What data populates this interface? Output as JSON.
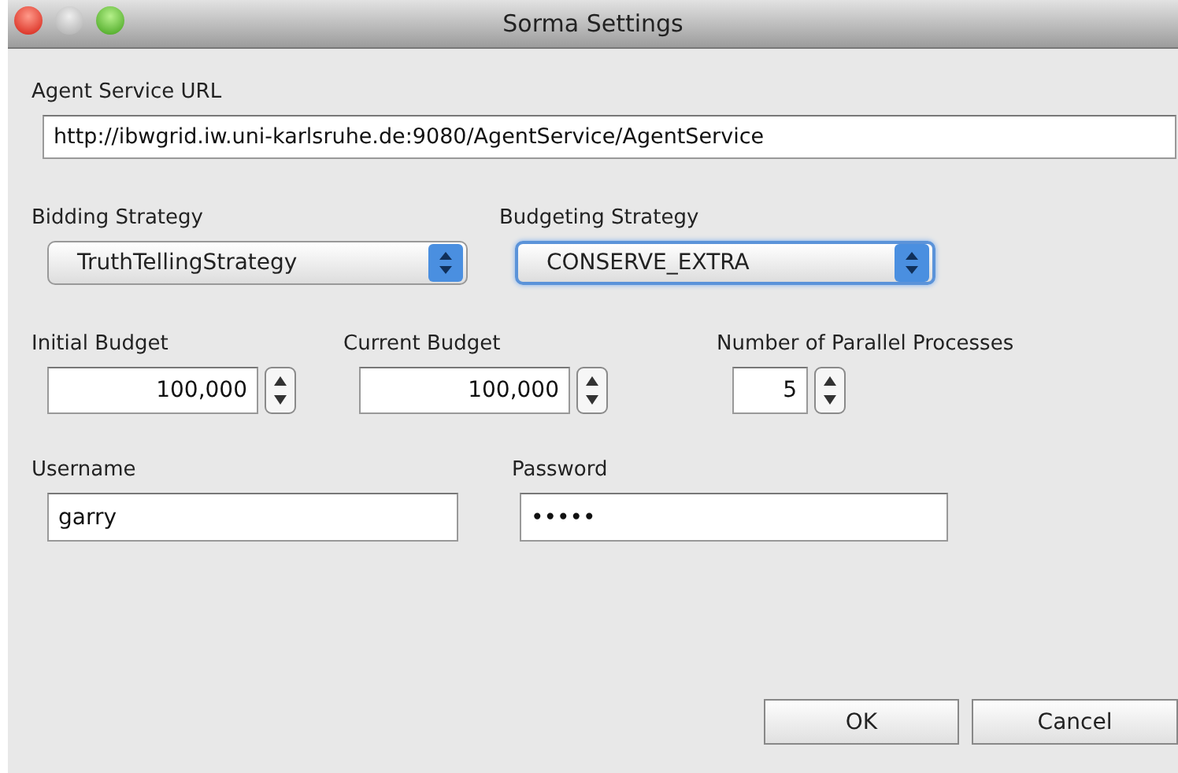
{
  "window": {
    "title": "Sorma Settings"
  },
  "url": {
    "label": "Agent Service URL",
    "value": "http://ibwgrid.iw.uni-karlsruhe.de:9080/AgentService/AgentService"
  },
  "selects": [
    {
      "label": "Bidding Strategy",
      "value": "TruthTellingStrategy",
      "focused": false
    },
    {
      "label": "Budgeting Strategy",
      "value": "CONSERVE_EXTRA",
      "focused": true
    }
  ],
  "spinners": [
    {
      "label": "Initial Budget",
      "value": "100,000"
    },
    {
      "label": "Current Budget",
      "value": "100,000"
    },
    {
      "label": "Number of Parallel Processes",
      "value": "5"
    }
  ],
  "credentials": [
    {
      "label": "Username",
      "value": "garry"
    },
    {
      "label": "Password",
      "value": "•••••"
    }
  ],
  "buttons": [
    "OK",
    "Cancel"
  ]
}
